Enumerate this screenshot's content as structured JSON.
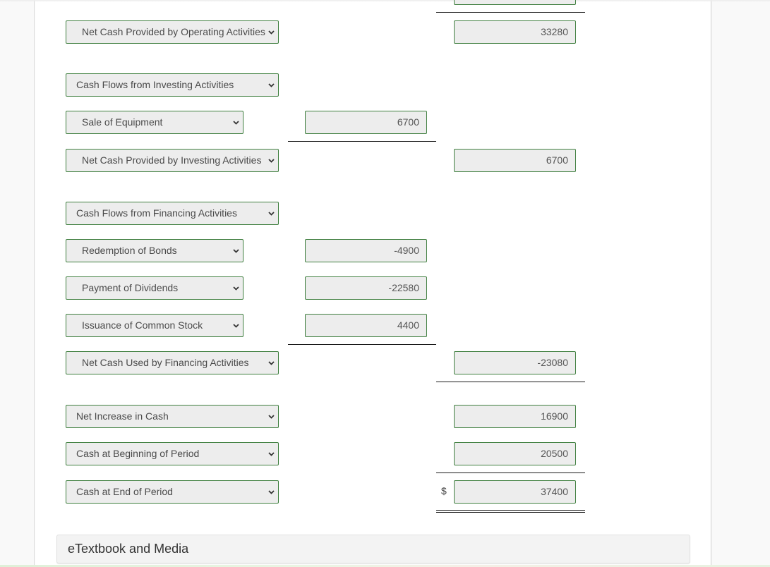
{
  "statement": {
    "rows": [
      {
        "id": "net-operating",
        "label": "Net Cash Provided by Operating Activities",
        "total": "33280"
      },
      {
        "id": "investing-header",
        "label": "Cash Flows from Investing Activities"
      },
      {
        "id": "sale-of-equipment",
        "label": "Sale of Equipment",
        "amount": "6700"
      },
      {
        "id": "net-investing",
        "label": "Net Cash Provided by Investing Activities",
        "total": "6700"
      },
      {
        "id": "financing-header",
        "label": "Cash Flows from Financing Activities"
      },
      {
        "id": "redemption-of-bonds",
        "label": "Redemption of Bonds",
        "amount": "-4900"
      },
      {
        "id": "payment-of-dividends",
        "label": "Payment of Dividends",
        "amount": "-22580"
      },
      {
        "id": "issuance-of-common-stock",
        "label": "Issuance of Common Stock",
        "amount": "4400"
      },
      {
        "id": "net-financing",
        "label": "Net Cash Used by Financing Activities",
        "total": "-23080"
      },
      {
        "id": "net-increase",
        "label": "Net Increase in Cash",
        "total": "16900"
      },
      {
        "id": "cash-beginning",
        "label": "Cash at Beginning of Period",
        "total": "20500"
      },
      {
        "id": "cash-end",
        "label": "Cash at End of Period",
        "total": "37400",
        "currency_symbol": "$"
      }
    ]
  },
  "etextbook": {
    "label": "eTextbook and Media"
  },
  "colors": {
    "field_border": "#3f7f3f",
    "field_background": "#ededed"
  }
}
